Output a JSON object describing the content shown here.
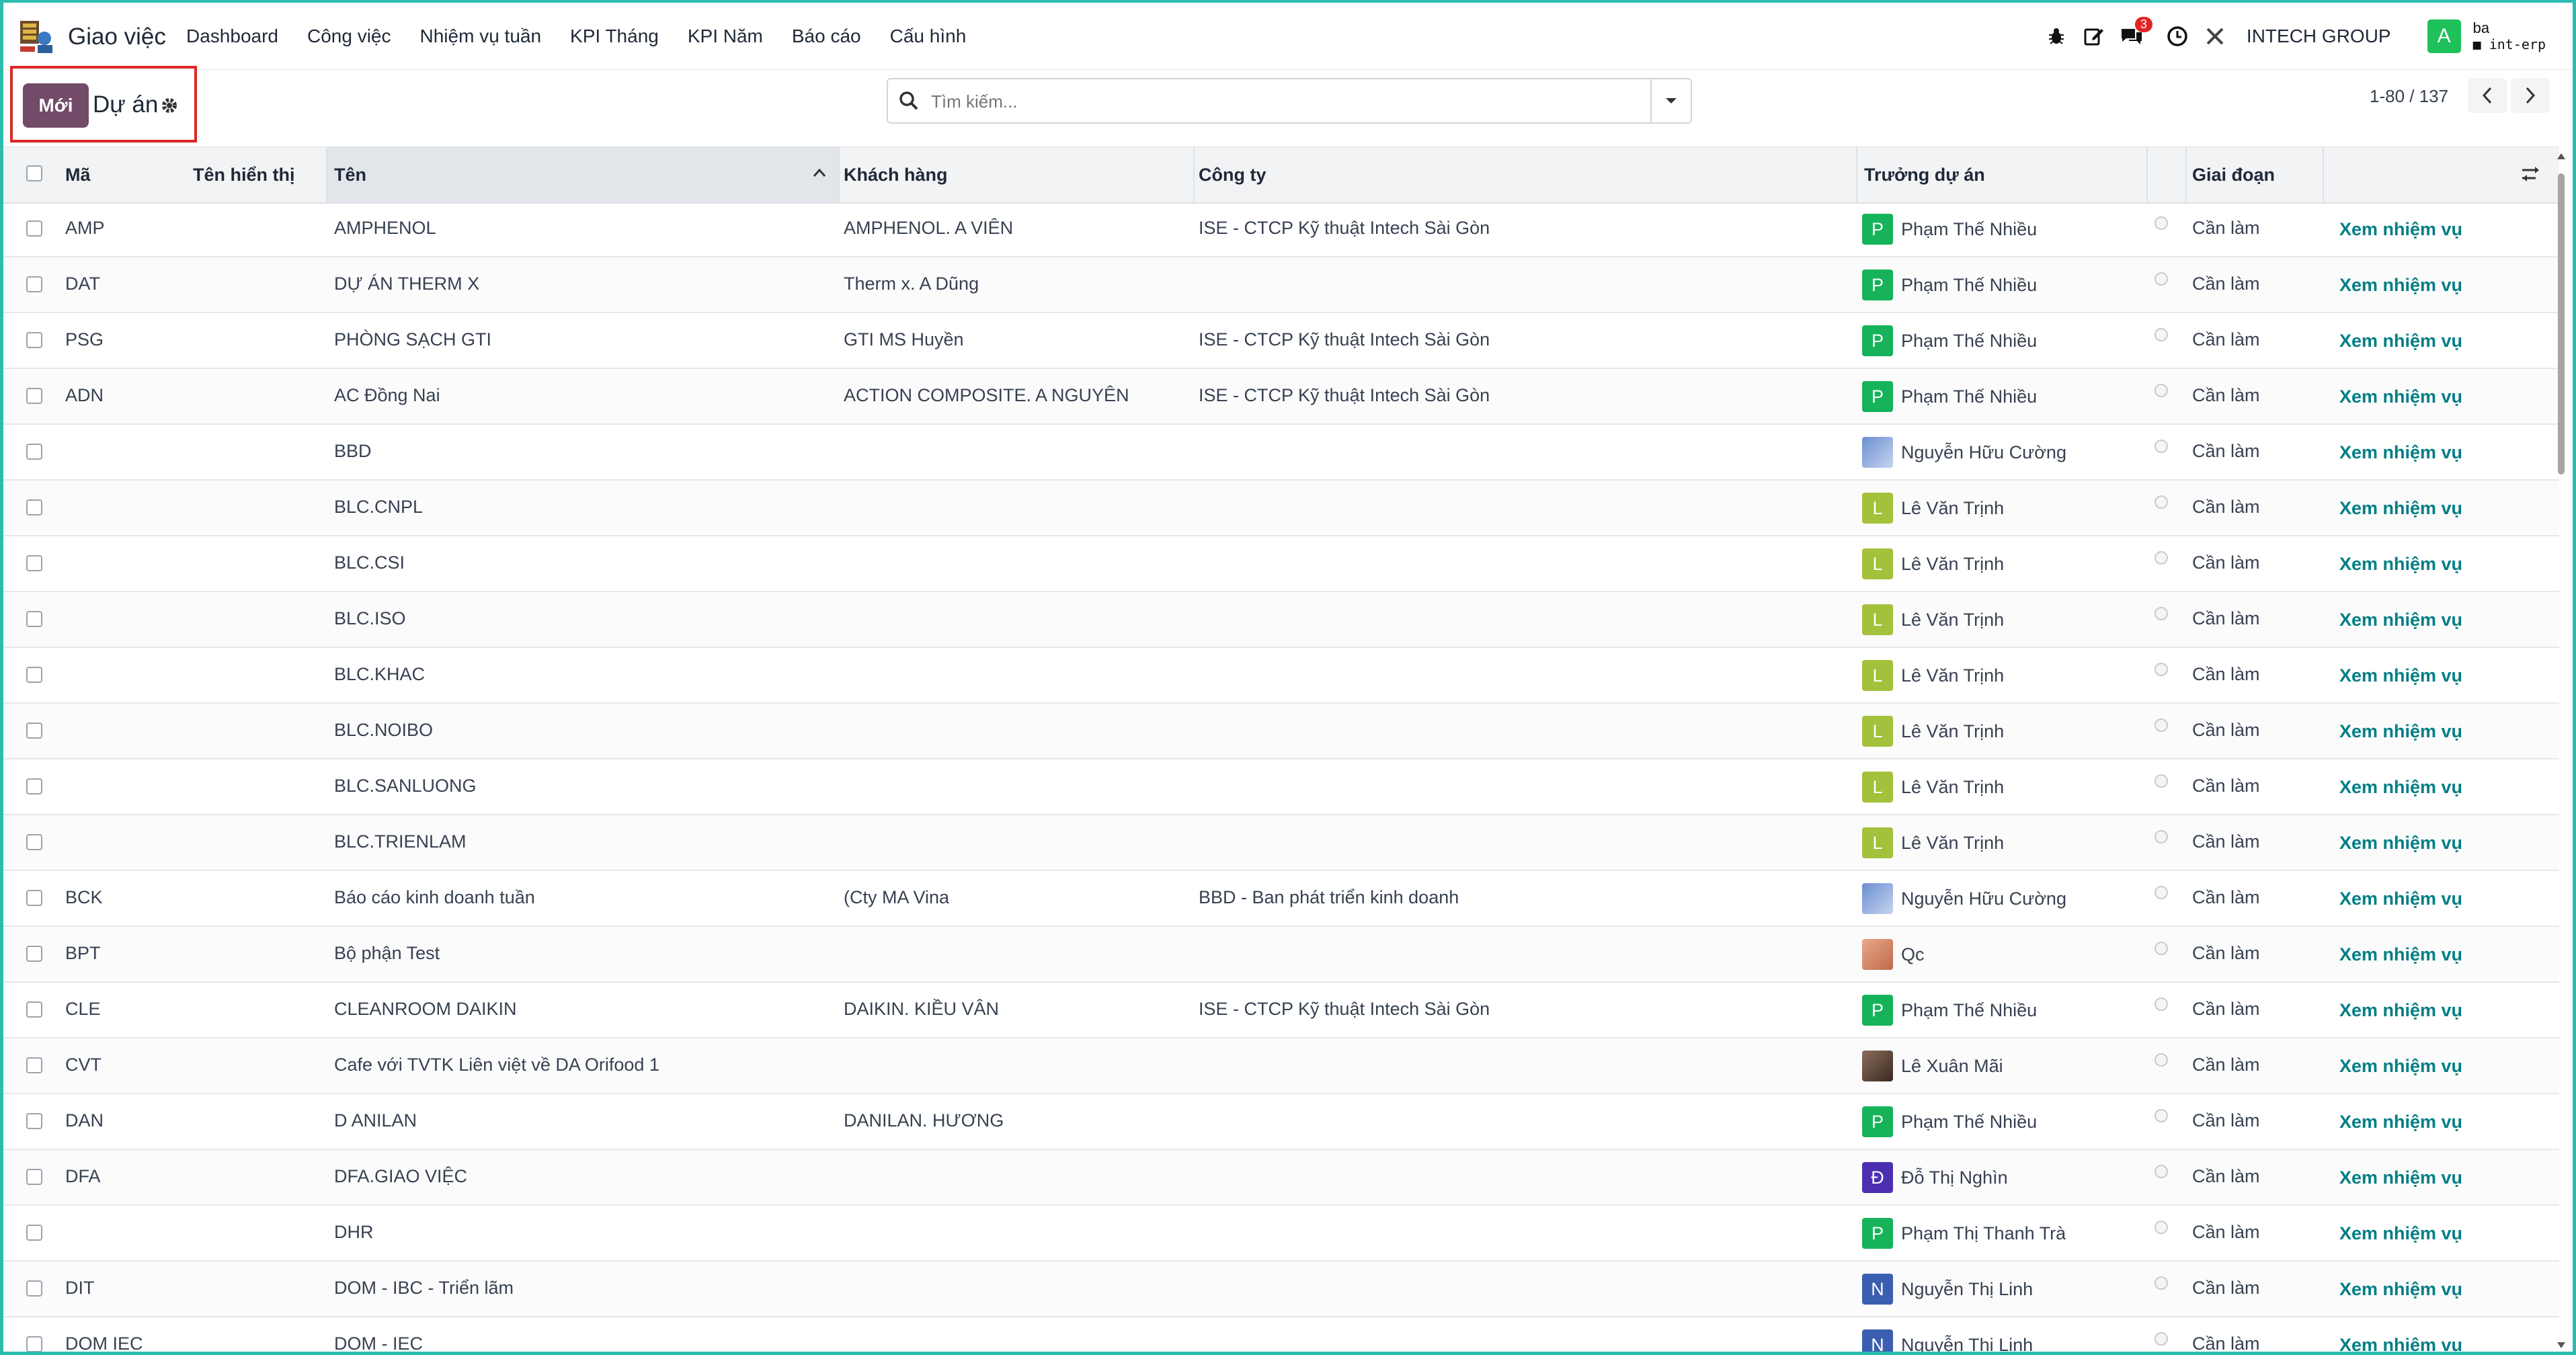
{
  "navbar": {
    "app_name": "Giao việc",
    "menu": [
      "Dashboard",
      "Công việc",
      "Nhiệm vụ tuần",
      "KPI Tháng",
      "KPI Năm",
      "Báo cáo",
      "Cấu hình"
    ],
    "message_count": "3",
    "company": "INTECH GROUP",
    "user_initial": "A",
    "user_name": "ba",
    "database": "int-erp"
  },
  "control_panel": {
    "new_button": "Mới",
    "breadcrumb": "Dự án",
    "search_placeholder": "Tìm kiếm...",
    "pager": "1-80 / 137"
  },
  "columns": {
    "code": "Mã",
    "display_name": "Tên hiển thị",
    "name": "Tên",
    "customer": "Khách hàng",
    "company": "Công ty",
    "manager": "Trưởng dự án",
    "stage": "Giai đoạn"
  },
  "rows": [
    {
      "code": "AMP",
      "name": "AMPHENOL",
      "customer": "AMPHENOL. A VIÊN",
      "company": "ISE - CTCP Kỹ thuật Intech Sài Gòn",
      "manager": "Phạm Thế Nhiều",
      "initial": "P",
      "avatar_color": "#16b35a",
      "stage": "Cần làm",
      "action": "Xem nhiệm vụ"
    },
    {
      "code": "DAT",
      "name": "DỰ ÁN THERM X",
      "customer": "Therm x. A Dũng",
      "company": "",
      "manager": "Phạm Thế Nhiều",
      "initial": "P",
      "avatar_color": "#16b35a",
      "stage": "Cần làm",
      "action": "Xem nhiệm vụ"
    },
    {
      "code": "PSG",
      "name": "PHÒNG SẠCH GTI",
      "customer": "GTI MS Huyền",
      "company": "ISE - CTCP Kỹ thuật Intech Sài Gòn",
      "manager": "Phạm Thế Nhiều",
      "initial": "P",
      "avatar_color": "#16b35a",
      "stage": "Cần làm",
      "action": "Xem nhiệm vụ"
    },
    {
      "code": "ADN",
      "name": "AC Đồng Nai",
      "customer": "ACTION COMPOSITE. A NGUYÊN",
      "company": "ISE - CTCP Kỹ thuật Intech Sài Gòn",
      "manager": "Phạm Thế Nhiều",
      "initial": "P",
      "avatar_color": "#16b35a",
      "stage": "Cần làm",
      "action": "Xem nhiệm vụ"
    },
    {
      "code": "",
      "name": "BBD",
      "customer": "",
      "company": "",
      "manager": "Nguyễn Hữu Cường",
      "initial": "",
      "avatar_color": "photo",
      "stage": "Cần làm",
      "action": "Xem nhiệm vụ"
    },
    {
      "code": "",
      "name": "BLC.CNPL",
      "customer": "",
      "company": "",
      "manager": "Lê Văn Trịnh",
      "initial": "L",
      "avatar_color": "#a3c13a",
      "stage": "Cần làm",
      "action": "Xem nhiệm vụ"
    },
    {
      "code": "",
      "name": "BLC.CSI",
      "customer": "",
      "company": "",
      "manager": "Lê Văn Trịnh",
      "initial": "L",
      "avatar_color": "#a3c13a",
      "stage": "Cần làm",
      "action": "Xem nhiệm vụ"
    },
    {
      "code": "",
      "name": "BLC.ISO",
      "customer": "",
      "company": "",
      "manager": "Lê Văn Trịnh",
      "initial": "L",
      "avatar_color": "#a3c13a",
      "stage": "Cần làm",
      "action": "Xem nhiệm vụ"
    },
    {
      "code": "",
      "name": "BLC.KHAC",
      "customer": "",
      "company": "",
      "manager": "Lê Văn Trịnh",
      "initial": "L",
      "avatar_color": "#a3c13a",
      "stage": "Cần làm",
      "action": "Xem nhiệm vụ"
    },
    {
      "code": "",
      "name": "BLC.NOIBO",
      "customer": "",
      "company": "",
      "manager": "Lê Văn Trịnh",
      "initial": "L",
      "avatar_color": "#a3c13a",
      "stage": "Cần làm",
      "action": "Xem nhiệm vụ"
    },
    {
      "code": "",
      "name": "BLC.SANLUONG",
      "customer": "",
      "company": "",
      "manager": "Lê Văn Trịnh",
      "initial": "L",
      "avatar_color": "#a3c13a",
      "stage": "Cần làm",
      "action": "Xem nhiệm vụ"
    },
    {
      "code": "",
      "name": "BLC.TRIENLAM",
      "customer": "",
      "company": "",
      "manager": "Lê Văn Trịnh",
      "initial": "L",
      "avatar_color": "#a3c13a",
      "stage": "Cần làm",
      "action": "Xem nhiệm vụ"
    },
    {
      "code": "BCK",
      "name": "Báo cáo kinh doanh tuần",
      "customer": "(Cty MA Vina",
      "company": "BBD - Ban phát triển kinh doanh",
      "manager": "Nguyễn Hữu Cường",
      "initial": "",
      "avatar_color": "photo",
      "stage": "Cần làm",
      "action": "Xem nhiệm vụ"
    },
    {
      "code": "BPT",
      "name": "Bộ phận Test",
      "customer": "",
      "company": "",
      "manager": "Qc",
      "initial": "",
      "avatar_color": "photo2",
      "stage": "Cần làm",
      "action": "Xem nhiệm vụ"
    },
    {
      "code": "CLE",
      "name": "CLEANROOM DAIKIN",
      "customer": "DAIKIN. KIỀU VÂN",
      "company": "ISE - CTCP Kỹ thuật Intech Sài Gòn",
      "manager": "Phạm Thế Nhiều",
      "initial": "P",
      "avatar_color": "#16b35a",
      "stage": "Cần làm",
      "action": "Xem nhiệm vụ"
    },
    {
      "code": "CVT",
      "name": "Cafe với TVTK Liên việt về DA Orifood 1",
      "customer": "",
      "company": "",
      "manager": "Lê Xuân Mãi",
      "initial": "",
      "avatar_color": "photo3",
      "stage": "Cần làm",
      "action": "Xem nhiệm vụ"
    },
    {
      "code": "DAN",
      "name": "D ANILAN",
      "customer": "DANILAN. HƯƠNG",
      "company": "",
      "manager": "Phạm Thế Nhiều",
      "initial": "P",
      "avatar_color": "#16b35a",
      "stage": "Cần làm",
      "action": "Xem nhiệm vụ"
    },
    {
      "code": "DFA",
      "name": "DFA.GIAO VIỆC",
      "customer": "",
      "company": "",
      "manager": "Đỗ Thị Nghìn",
      "initial": "Đ",
      "avatar_color": "#4c2fb0",
      "stage": "Cần làm",
      "action": "Xem nhiệm vụ"
    },
    {
      "code": "",
      "name": "DHR",
      "customer": "",
      "company": "",
      "manager": "Phạm Thị Thanh Trà",
      "initial": "P",
      "avatar_color": "#16b35a",
      "stage": "Cần làm",
      "action": "Xem nhiệm vụ"
    },
    {
      "code": "DIT",
      "name": "DOM - IBC - Triển lãm",
      "customer": "",
      "company": "",
      "manager": "Nguyễn Thị Linh",
      "initial": "N",
      "avatar_color": "#3a5fb0",
      "stage": "Cần làm",
      "action": "Xem nhiệm vụ"
    },
    {
      "code": "DOM IEC",
      "name": "DOM - IEC",
      "customer": "",
      "company": "",
      "manager": "Nguyễn Thị Linh",
      "initial": "N",
      "avatar_color": "#3a5fb0",
      "stage": "Cần làm",
      "action": "Xem nhiệm vụ"
    }
  ]
}
